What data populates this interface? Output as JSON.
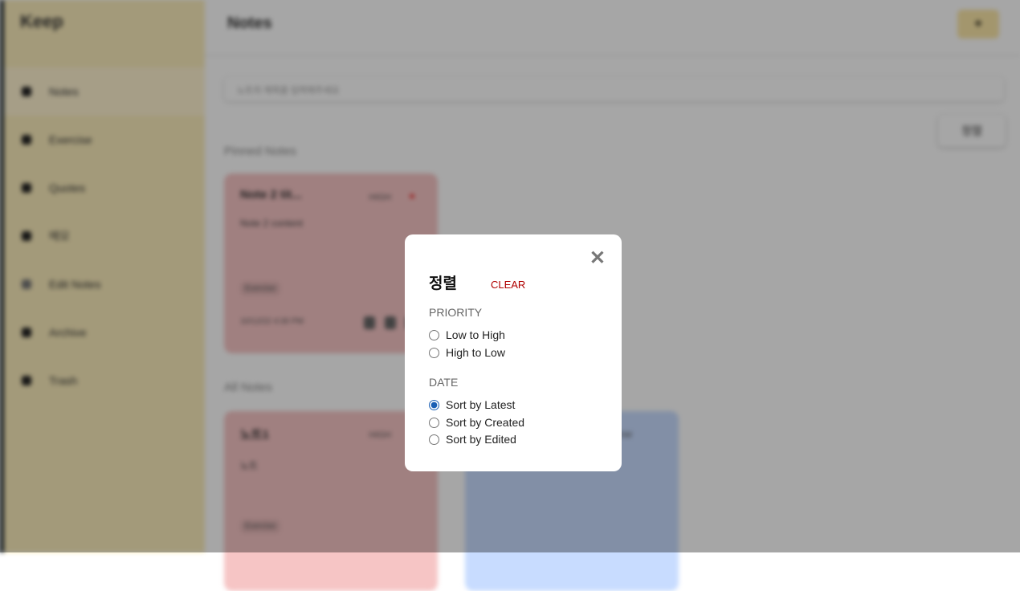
{
  "sidebar": {
    "logo": "Keep",
    "items": [
      {
        "label": "Notes",
        "icon": "lightbulb-icon",
        "active": true
      },
      {
        "label": "Exercise",
        "icon": "tag-icon"
      },
      {
        "label": "Quotes",
        "icon": "tag-icon"
      },
      {
        "label": "메모",
        "icon": "tag-icon"
      },
      {
        "label": "Edit Notes",
        "icon": "pencil-icon"
      },
      {
        "label": "Archive",
        "icon": "archive-icon"
      },
      {
        "label": "Trash",
        "icon": "trash-icon"
      }
    ]
  },
  "header": {
    "title": "Notes",
    "add_label": "+"
  },
  "search": {
    "placeholder": "노트의 제목을 입력해주세요"
  },
  "sort_button": "정렬",
  "pinned": {
    "title": "Pinned Notes",
    "cards": [
      {
        "title": "Note 2 tit...",
        "priority": "HIGH",
        "content": "Note 2 content",
        "tag": "Exercise",
        "date": "10/12/22 4:30 PM",
        "color": "#f6c5c5"
      }
    ]
  },
  "all": {
    "title": "All Notes",
    "cards": [
      {
        "title": "노트1",
        "priority": "HIGH",
        "content": "노트",
        "tag": "Exercise",
        "color": "#f6c5c5"
      },
      {
        "title": "",
        "priority": "LOW",
        "content": "",
        "tag": "",
        "color": "#c8dcff"
      }
    ]
  },
  "modal": {
    "title": "정렬",
    "clear_label": "CLEAR",
    "close_icon": "close-icon",
    "priority_label": "PRIORITY",
    "priority_options": [
      "Low to High",
      "High to Low"
    ],
    "date_label": "DATE",
    "date_options": [
      "Sort by Latest",
      "Sort by Created",
      "Sort by Edited"
    ],
    "selected_date": "Sort by Latest",
    "accent": "#b00000"
  }
}
